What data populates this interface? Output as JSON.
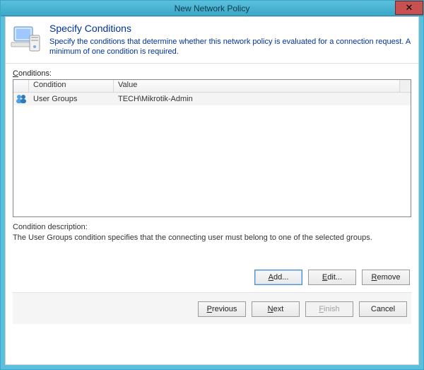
{
  "window": {
    "title": "New Network Policy",
    "close_glyph": "✕"
  },
  "header": {
    "title": "Specify Conditions",
    "subtitle": "Specify the conditions that determine whether this network policy is evaluated for a connection request. A minimum of one condition is required."
  },
  "conditions": {
    "label_prefix": "C",
    "label_rest": "onditions:",
    "columns": {
      "condition": "Condition",
      "value": "Value"
    },
    "rows": [
      {
        "icon": "user-groups-icon",
        "condition": "User Groups",
        "value": "TECH\\Mikrotik-Admin"
      }
    ]
  },
  "description": {
    "label": "Condition description:",
    "text": "The User Groups condition specifies that the connecting user must belong to one of the selected groups."
  },
  "buttons": {
    "add_u": "A",
    "add_rest": "dd...",
    "edit_u": "E",
    "edit_rest": "dit...",
    "remove_u": "R",
    "remove_rest": "emove",
    "prev_u": "P",
    "prev_rest": "revious",
    "next_u": "N",
    "next_rest": "ext",
    "finish_u": "F",
    "finish_rest": "inish",
    "cancel": "Cancel"
  }
}
